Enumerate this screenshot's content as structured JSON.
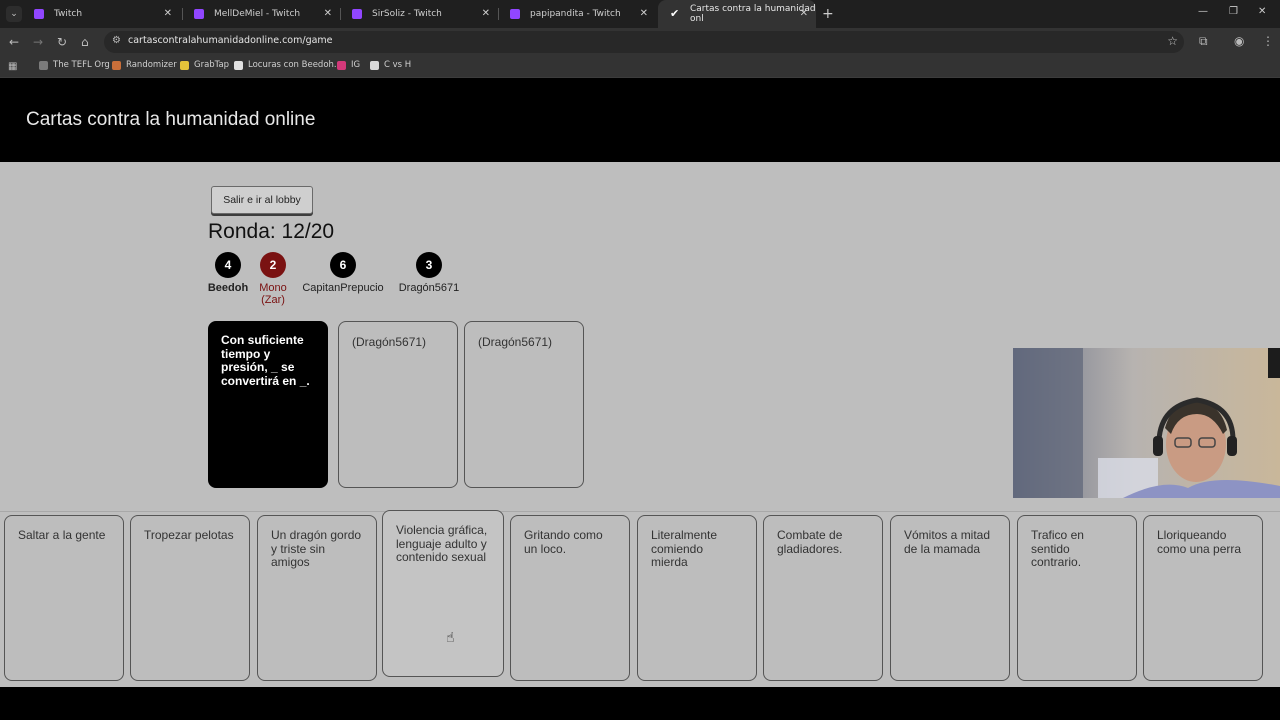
{
  "browser": {
    "tabs": [
      {
        "label": "Twitch"
      },
      {
        "label": "MellDeMiel - Twitch"
      },
      {
        "label": "SirSoliz - Twitch"
      },
      {
        "label": "papipandita - Twitch"
      },
      {
        "label": "Cartas contra la humanidad onl"
      }
    ],
    "url": "cartascontralahumanidadonline.com/game",
    "bookmarks": [
      {
        "label": "The TEFL Org",
        "color": "#7b7b7b"
      },
      {
        "label": "Randomizer",
        "color": "#c96f3a"
      },
      {
        "label": "GrabTap",
        "color": "#e3c33a"
      },
      {
        "label": "Locuras con Beedoh...",
        "color": "#e0e0e0"
      },
      {
        "label": "IG",
        "color": "#d3397a"
      },
      {
        "label": "C vs H",
        "color": "#d8d8d8"
      }
    ]
  },
  "site": {
    "title": "Cartas contra la humanidad online"
  },
  "game": {
    "lobby_button": "Salir e ir al lobby",
    "round": "Ronda: 12/20",
    "players": [
      {
        "score": "4",
        "name": "Beedoh",
        "czar": false
      },
      {
        "score": "2",
        "name": "Mono",
        "czar_label": "(Zar)",
        "czar": true
      },
      {
        "score": "6",
        "name": "CapitanPrepucio",
        "czar": false
      },
      {
        "score": "3",
        "name": "Dragón5671",
        "czar": false
      }
    ],
    "black_card": "Con suficiente tiempo y presión, _ se convertirá en _.",
    "played_cards": [
      "(Dragón5671)",
      "(Dragón5671)"
    ],
    "hand": [
      "Saltar a la gente",
      "Tropezar pelotas",
      "Un dragón gordo y triste sin amigos",
      "Violencia gráfica, lenguaje adulto y contenido sexual",
      "Gritando como un loco.",
      "Literalmente comiendo mierda",
      "Combate de gladiadores.",
      "Vómitos a mitad de la mamada",
      "Trafico en sentido contrario.",
      "Lloriqueando como una perra"
    ]
  }
}
